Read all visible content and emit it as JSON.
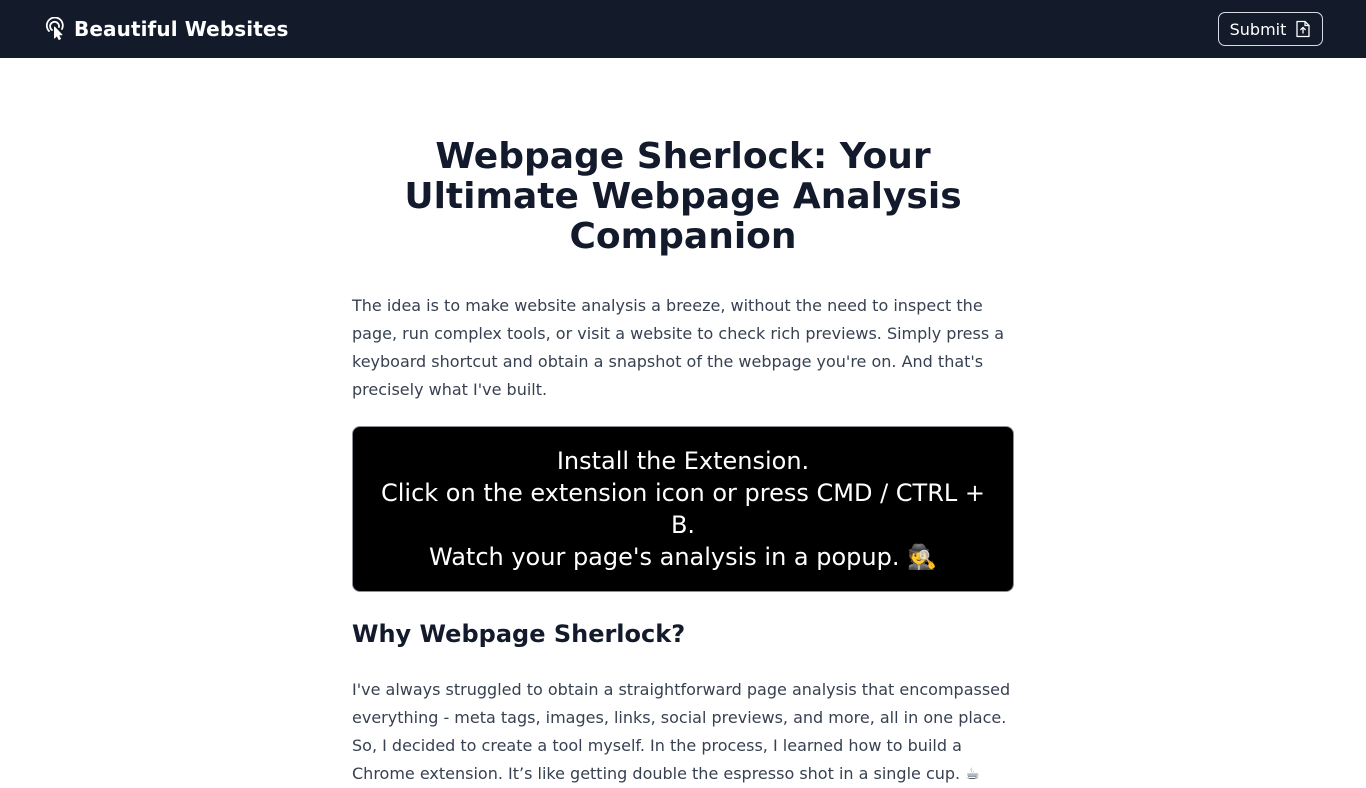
{
  "navbar": {
    "brand_icon": "pointer-click-icon",
    "brand_name": "Beautiful Websites",
    "submit_label": "Submit",
    "submit_icon": "file-upload-icon",
    "background": "#131a2a"
  },
  "main": {
    "title": "Webpage Sherlock: Your Ultimate Webpage Analysis Companion",
    "intro": "The idea is to make website analysis a breeze, without the need to inspect the page, run complex tools, or visit a website to check rich previews. Simply press a keyboard shortcut and obtain a snapshot of the webpage you're on. And that's precisely what I've built.",
    "steps": [
      "Install the Extension.",
      "Click on the extension icon or press CMD / CTRL + B.",
      "Watch your page's analysis in a popup. 🕵"
    ],
    "why_heading": "Why Webpage Sherlock?",
    "why_text": "I've always struggled to obtain a straightforward page analysis that encompassed everything - meta tags, images, links, social previews, and more, all in one place. So, I decided to create a tool myself. In the process, I learned how to build a Chrome extension. It’s like getting double the espresso shot in a single cup. ☕"
  }
}
